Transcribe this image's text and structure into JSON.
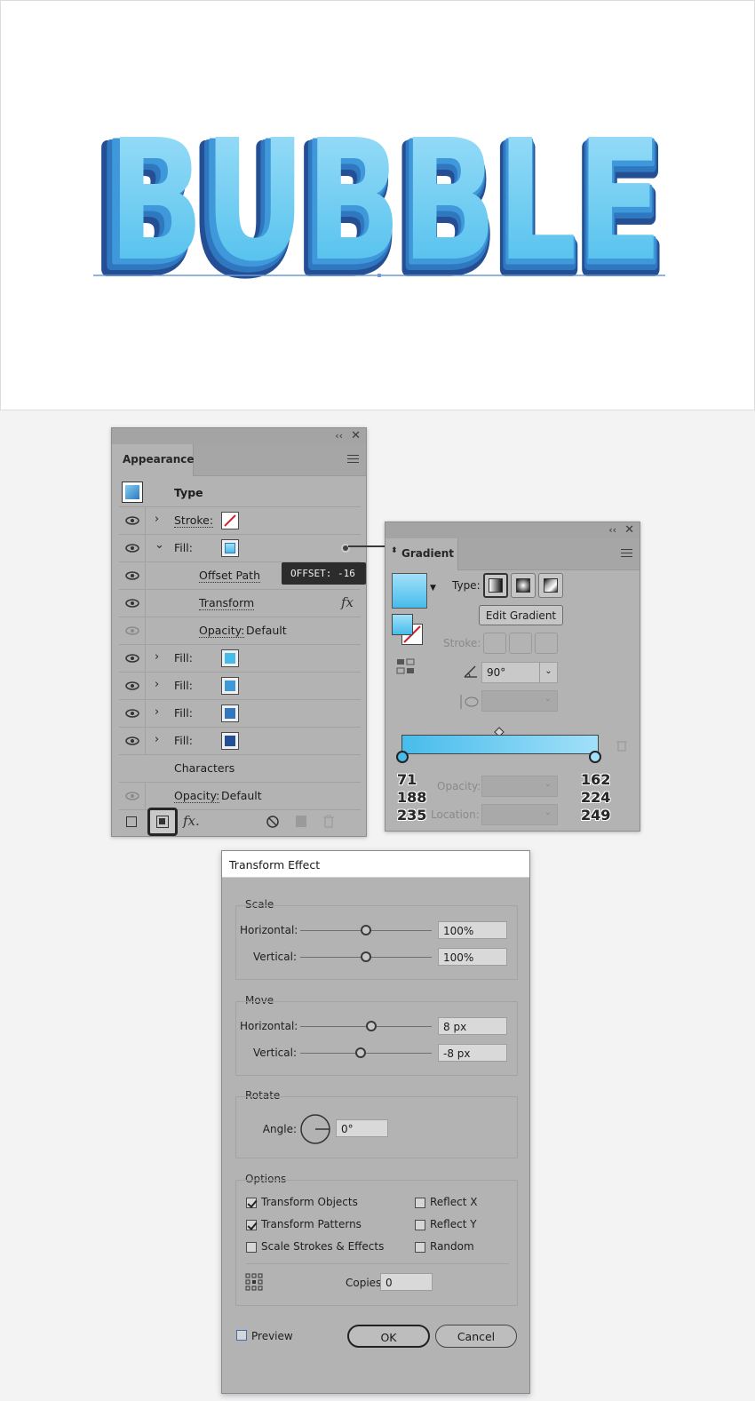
{
  "artboard": {
    "text": "BUBBLE"
  },
  "appearance": {
    "tab": "Appearance",
    "rows": [
      {
        "label": "Type"
      },
      {
        "label": "Stroke:"
      },
      {
        "label": "Fill:"
      },
      {
        "label": "Offset Path"
      },
      {
        "label": "Transform"
      },
      {
        "label": "Opacity:",
        "value": "Default"
      },
      {
        "label": "Fill:",
        "color": "#47bcec"
      },
      {
        "label": "Fill:",
        "color": "#3f98da"
      },
      {
        "label": "Fill:",
        "color": "#2f78c0"
      },
      {
        "label": "Fill:",
        "color": "#244f94"
      },
      {
        "label": "Characters"
      },
      {
        "label": "Opacity:",
        "value": "Default"
      }
    ],
    "icons": [
      "eye-icon",
      "chevron-right-icon",
      "chevron-down-icon",
      "fx-icon",
      "no-icon",
      "duplicate-icon",
      "trash-icon"
    ]
  },
  "tooltip": {
    "text": "OFFSET: -16"
  },
  "gradient": {
    "tab": "Gradient",
    "type_label": "Type:",
    "edit_button": "Edit Gradient",
    "stroke_label": "Stroke:",
    "angle": "90°",
    "opacity_label": "Opacity:",
    "location_label": "Location:",
    "start_color": {
      "r": "71",
      "g": "188",
      "b": "235",
      "hex": "#47bceb"
    },
    "end_color": {
      "r": "162",
      "g": "224",
      "b": "249",
      "hex": "#a2e0f9"
    }
  },
  "transform_effect": {
    "title": "Transform Effect",
    "scale": {
      "label": "Scale",
      "horizontal_label": "Horizontal:",
      "horizontal": "100%",
      "vertical_label": "Vertical:",
      "vertical": "100%"
    },
    "move": {
      "label": "Move",
      "horizontal_label": "Horizontal:",
      "horizontal": "8 px",
      "vertical_label": "Vertical:",
      "vertical": "-8 px"
    },
    "rotate": {
      "label": "Rotate",
      "angle_label": "Angle:",
      "angle": "0°"
    },
    "options": {
      "label": "Options",
      "transform_objects": "Transform Objects",
      "transform_patterns": "Transform Patterns",
      "scale_strokes": "Scale Strokes & Effects",
      "reflect_x": "Reflect X",
      "reflect_y": "Reflect Y",
      "random": "Random",
      "copies_label": "Copies",
      "copies": "0"
    },
    "preview": "Preview",
    "ok": "OK",
    "cancel": "Cancel"
  }
}
